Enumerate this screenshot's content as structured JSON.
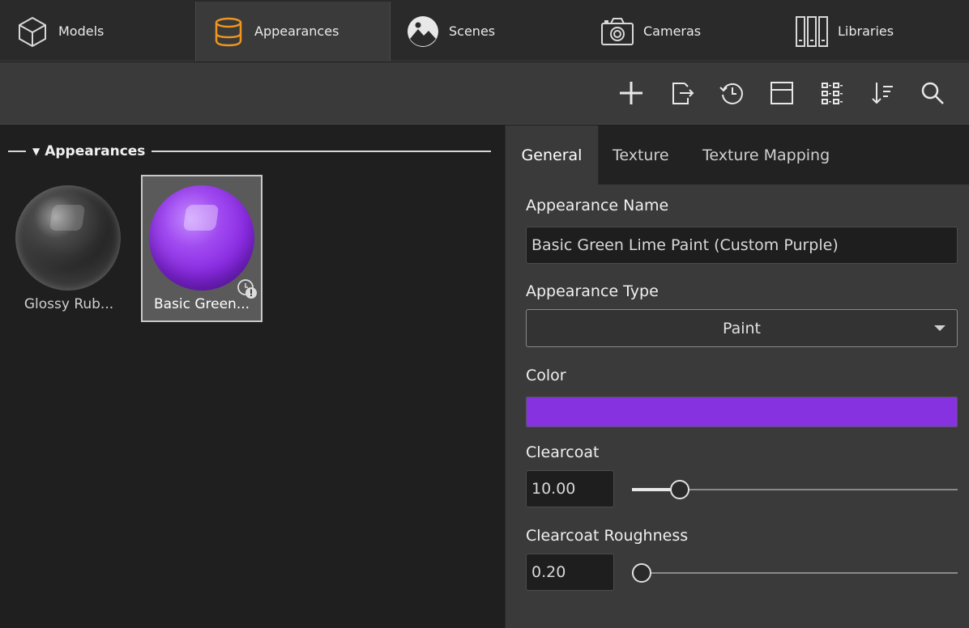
{
  "top_tabs": [
    {
      "label": "Models",
      "icon": "cube-icon",
      "active": false
    },
    {
      "label": "Appearances",
      "icon": "paint-can-icon",
      "active": true
    },
    {
      "label": "Scenes",
      "icon": "landscape-icon",
      "active": false
    },
    {
      "label": "Cameras",
      "icon": "camera-icon",
      "active": false
    },
    {
      "label": "Libraries",
      "icon": "library-books-icon",
      "active": false
    }
  ],
  "toolbar": {
    "icons": [
      "add-icon",
      "export-icon",
      "history-icon",
      "panel-layout-icon",
      "grid-view-icon",
      "sort-icon",
      "search-icon"
    ]
  },
  "library": {
    "section_title": "Appearances",
    "items": [
      {
        "label": "Glossy Rub...",
        "selected": false
      },
      {
        "label": "Basic Green...",
        "selected": true
      }
    ]
  },
  "properties": {
    "tabs": [
      "General",
      "Texture",
      "Texture Mapping"
    ],
    "active_tab": "General",
    "name_label": "Appearance Name",
    "name_value": "Basic Green Lime Paint (Custom Purple)",
    "type_label": "Appearance Type",
    "type_value": "Paint",
    "color_label": "Color",
    "color_value": "#8732e0",
    "clearcoat_label": "Clearcoat",
    "clearcoat_value": "10.00",
    "clearcoat_level": 0.125,
    "roughness_label": "Clearcoat Roughness",
    "roughness_value": "0.20",
    "roughness_level": 0.0
  },
  "colors": {
    "accent": "#f0961e",
    "purple": "#8732e0"
  }
}
